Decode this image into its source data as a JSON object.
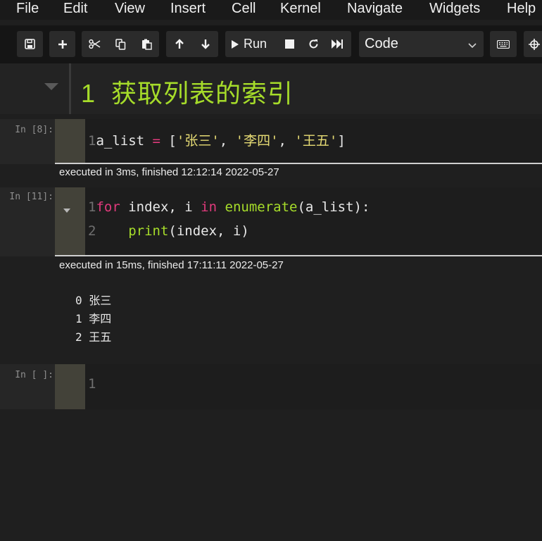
{
  "menubar": {
    "items": [
      "File",
      "Edit",
      "View",
      "Insert",
      "Cell",
      "Kernel",
      "Navigate",
      "Widgets",
      "Help"
    ]
  },
  "toolbar": {
    "run_label": "Run",
    "cell_type": "Code",
    "icons": [
      "save-icon",
      "plus-icon",
      "scissors-icon",
      "copy-icon",
      "paste-icon",
      "arrow-up-icon",
      "arrow-down-icon",
      "play-icon",
      "stop-icon",
      "restart-icon",
      "fast-forward-icon",
      "keyboard-icon",
      "move-icon"
    ]
  },
  "notebook": {
    "heading": {
      "number": "1",
      "text": "获取列表的索引"
    },
    "cells": [
      {
        "prompt": "In [8]:",
        "lines": [
          {
            "num": "1",
            "code": "a_list = ['张三', '李四', '王五']"
          }
        ],
        "exec_info": "executed in 3ms, finished 12:12:14 2022-05-27"
      },
      {
        "prompt": "In [11]:",
        "lines": [
          {
            "num": "1",
            "code": "for index, i in enumerate(a_list):"
          },
          {
            "num": "2",
            "code": "    print(index, i)"
          }
        ],
        "exec_info": "executed in 15ms, finished 17:11:11 2022-05-27",
        "output": [
          "0 张三",
          "1 李四",
          "2 王五"
        ]
      },
      {
        "prompt": "In [ ]:",
        "lines": [
          {
            "num": "1",
            "code": ""
          }
        ]
      }
    ]
  },
  "colors": {
    "heading": "#a6dc2a",
    "keyword": "#e03a7c",
    "function": "#a6dc2a",
    "string": "#e6db74",
    "gutter": "#434239"
  }
}
